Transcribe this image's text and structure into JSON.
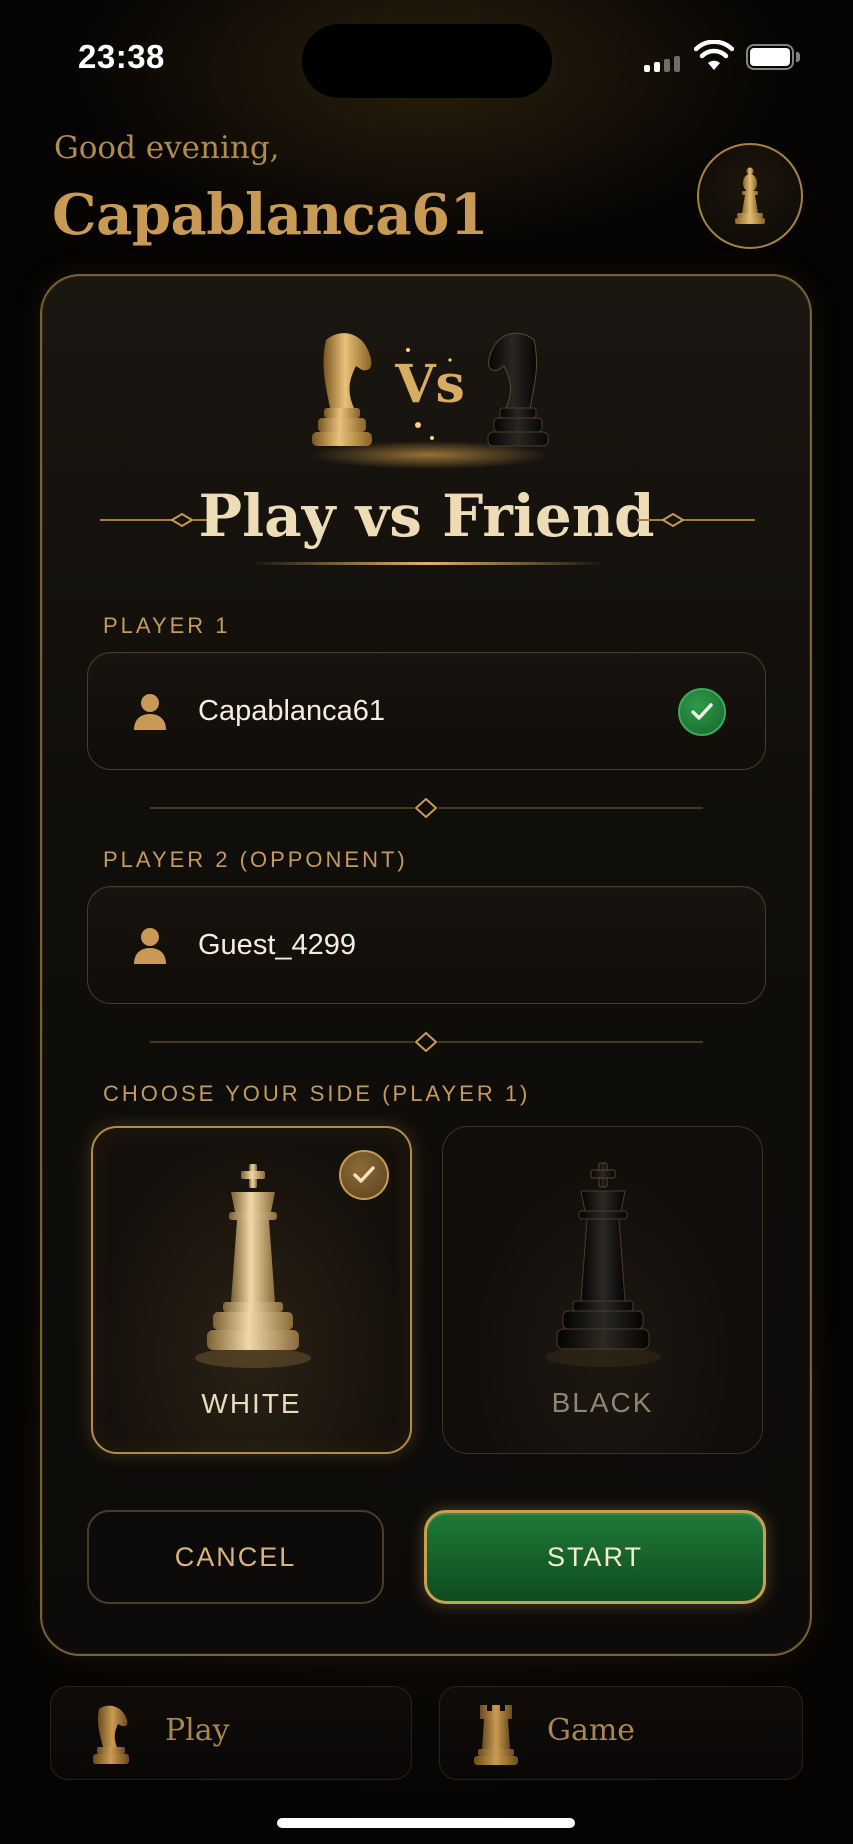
{
  "status_bar": {
    "time": "23:38"
  },
  "header": {
    "greeting": "Good evening,",
    "username": "Capablanca61"
  },
  "card": {
    "hero_vs": "Vs",
    "title": "Play vs Friend",
    "player1": {
      "label": "PLAYER 1",
      "value": "Capablanca61",
      "verified": true
    },
    "player2": {
      "label": "PLAYER 2 (OPPONENT)",
      "value": "Guest_4299"
    },
    "side": {
      "label": "CHOOSE YOUR SIDE (PLAYER 1)",
      "options": [
        {
          "label": "WHITE",
          "selected": true
        },
        {
          "label": "BLACK",
          "selected": false
        }
      ]
    },
    "buttons": {
      "cancel": "CANCEL",
      "start": "START"
    }
  },
  "tabs": [
    {
      "label": "Play",
      "icon": "knight-icon"
    },
    {
      "label": "Game",
      "icon": "rook-icon"
    }
  ],
  "colors": {
    "gold": "#c89a55",
    "start_green": "#1f7a37",
    "check_green": "#2f9a49",
    "background": "#050403"
  }
}
